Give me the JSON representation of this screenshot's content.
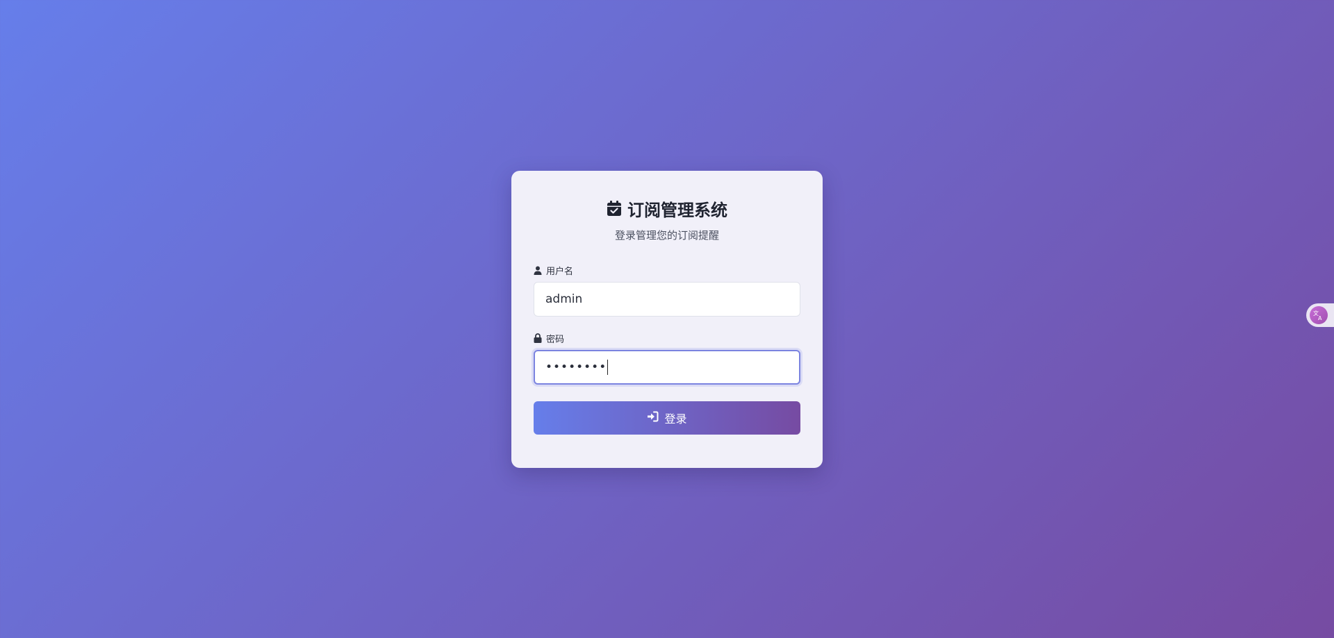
{
  "app": {
    "title": "订阅管理系统",
    "subtitle": "登录管理您的订阅提醒"
  },
  "form": {
    "username": {
      "label": "用户名",
      "value": "admin",
      "icon": "user-icon"
    },
    "password": {
      "label": "密码",
      "masked_value": "••••••••",
      "icon": "lock-icon"
    },
    "login_button": {
      "label": "登录",
      "icon": "sign-in-icon"
    }
  },
  "widgets": {
    "translate_icon": "translate-icon"
  },
  "colors": {
    "bg_start": "#667eea",
    "bg_end": "#764ba2",
    "card_bg": "#f1f0f9",
    "title_text": "#1f2330",
    "focus_border": "#7b83e0"
  }
}
